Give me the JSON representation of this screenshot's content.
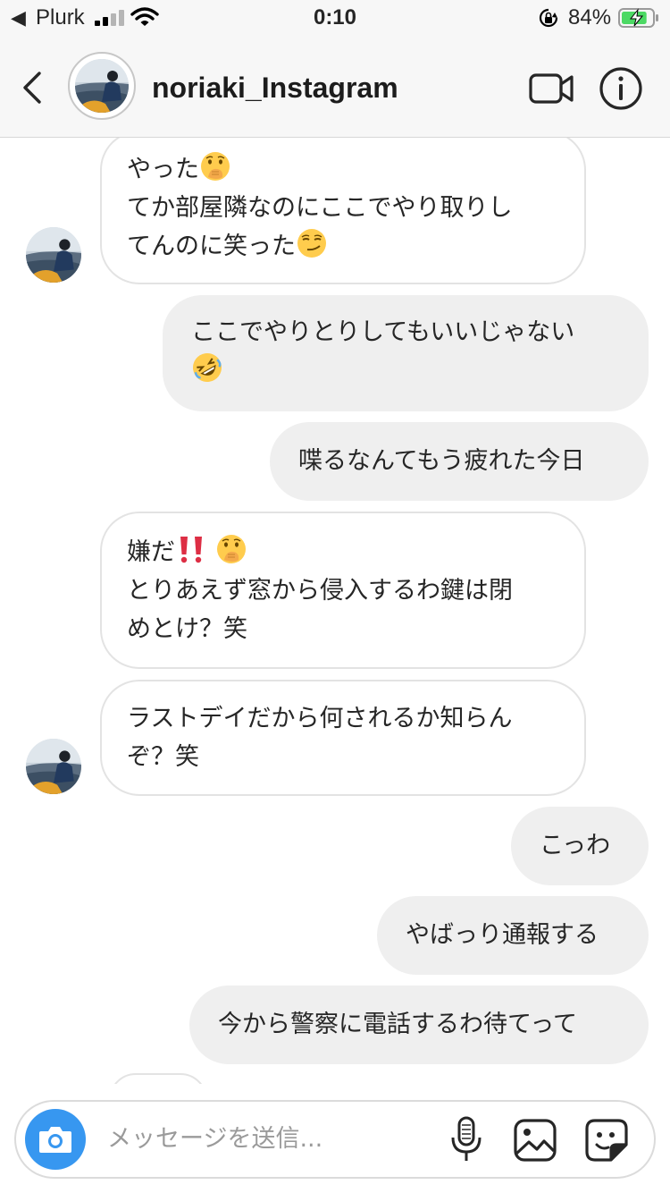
{
  "status_bar": {
    "back_glyph": "◀",
    "carrier": "Plurk",
    "time": "0:10",
    "battery_percent": "84%",
    "battery_level": 0.84,
    "signal_bars": 2,
    "icons": [
      "signal-icon",
      "wifi-icon",
      "orientation-lock-icon",
      "battery-charging-icon"
    ]
  },
  "header": {
    "title": "noriaki_Instagram",
    "icons": [
      "back-chevron-icon",
      "video-call-icon",
      "info-icon"
    ]
  },
  "messages": [
    {
      "from": "them",
      "text": "やった",
      "emoji": [
        "face-with-hand-over-mouth"
      ]
    },
    {
      "from": "them",
      "text": "てか部屋隣なのにここでやり取りし\nてんのに笑った",
      "emoji": [
        "smirking-face"
      ]
    },
    {
      "from": "me",
      "text": "ここでやりとりしてもいいじゃない",
      "emoji": [
        "rolling-on-the-floor-laughing"
      ]
    },
    {
      "from": "me",
      "text": "喋るなんてもう疲れた今日"
    },
    {
      "from": "them",
      "text": "嫌だ",
      "emoji": [
        "double-exclamation-mark",
        "face-with-hand-over-mouth"
      ]
    },
    {
      "from": "them",
      "text": "とりあえず窓から侵入するわ鍵は閉\nめとけ？笑"
    },
    {
      "from": "them",
      "text": "ラストデイだから何されるか知らん\nぞ？笑"
    },
    {
      "from": "me",
      "text": "こっわ"
    },
    {
      "from": "me",
      "text": "やばっり通報する"
    },
    {
      "from": "me",
      "text": "今から警察に電話するわ待てって"
    }
  ],
  "composer": {
    "placeholder": "メッセージを送信...",
    "icons": [
      "camera-icon",
      "microphone-icon",
      "gallery-icon",
      "sticker-icon"
    ]
  },
  "colors": {
    "incoming_bubble_border": "#e3e3e3",
    "outgoing_bubble_bg": "#efefef",
    "camera_button": "#3797f0",
    "header_bg": "#f7f7f7",
    "battery_green": "#4cd964"
  }
}
